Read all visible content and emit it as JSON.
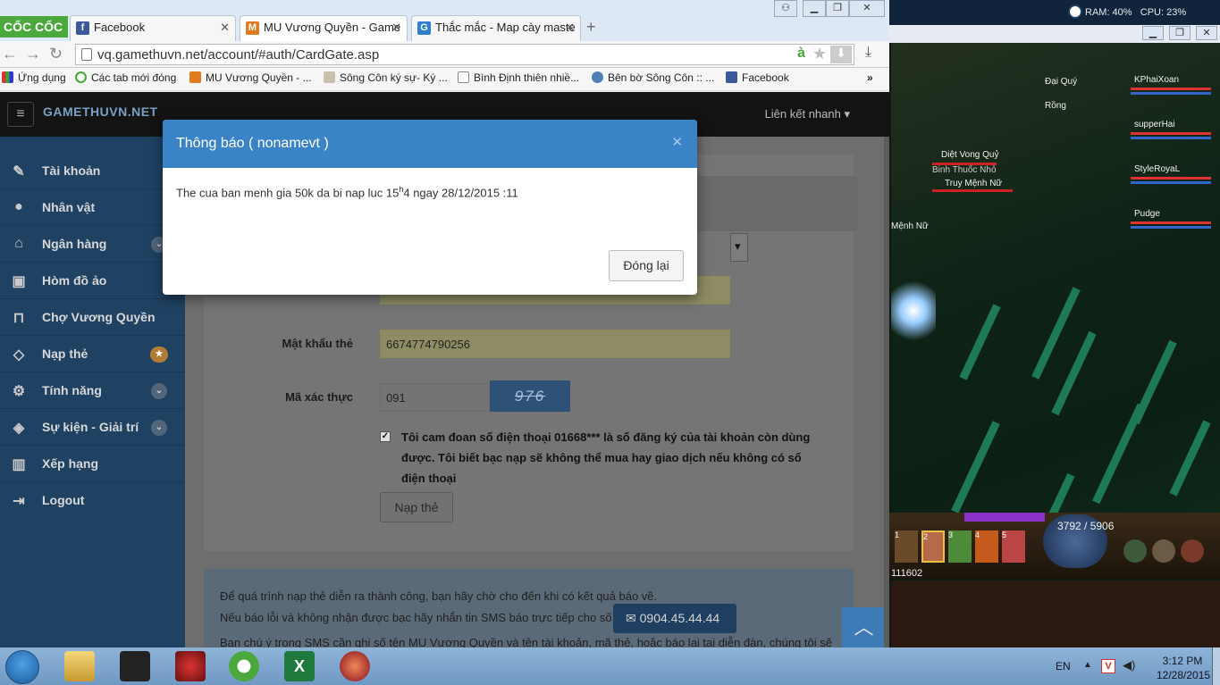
{
  "browser": {
    "brand": "CỐC CỐC",
    "tabs": [
      {
        "label": "Facebook",
        "icon": "facebook-icon"
      },
      {
        "label": "MU Vương Quyền - Game",
        "icon": "mu-icon"
      },
      {
        "label": "Thắc mắc - Map cày maste",
        "icon": "g-icon"
      }
    ],
    "url": "vq.gamethuvn.net/account/#auth/CardGate.asp",
    "bookmarks": [
      "Ứng dụng",
      "Các tab mới đóng",
      "MU Vương Quyền - ...",
      "Sông Côn ký sự- Ký ...",
      "Bình Định thiên nhiề...",
      "Bên bờ Sông Côn :: ...",
      "Facebook"
    ],
    "bookmarks_more": "»"
  },
  "site": {
    "logo": "GAMETHUVN.NET",
    "quick_link": "Liên kết nhanh ▾",
    "menu": [
      {
        "label": "Tài khoản",
        "icon": "edit-icon"
      },
      {
        "label": "Nhân vật",
        "icon": "user-icon"
      },
      {
        "label": "Ngân hàng",
        "icon": "bank-icon"
      },
      {
        "label": "Hòm đồ ảo",
        "icon": "briefcase-icon"
      },
      {
        "label": "Chợ Vương Quyền",
        "icon": "cart-icon"
      },
      {
        "label": "Nạp thẻ",
        "icon": "diamond-icon"
      },
      {
        "label": "Tính năng",
        "icon": "gears-icon"
      },
      {
        "label": "Sự kiện - Giải trí",
        "icon": "handshake-icon"
      },
      {
        "label": "Xếp hạng",
        "icon": "bar-chart-icon"
      },
      {
        "label": "Logout",
        "icon": "sign-out-icon"
      }
    ],
    "form": {
      "password_label": "Mật khẩu thẻ",
      "password_value": "6674774790256",
      "captcha_label": "Mã xác thực",
      "captcha_value": "091",
      "captcha_image_text": "976",
      "agree_text": "Tôi cam đoan số điện thoại 01668*** là số đăng ký của tài khoản còn dùng được. Tôi biết bạc nạp sẽ không thể mua hay giao dịch nếu không có số điện thoại",
      "submit": "Nạp thẻ"
    },
    "info": {
      "line1": "Để quá trình nạp thẻ diễn ra thành công, bạn hãy chờ cho đến khi có kết quả báo về.",
      "line2": "Nếu báo lỗi và không nhận được bạc hãy nhắn tin SMS báo trực tiếp cho số:",
      "phone": "0904.45.44.44",
      "line3": "Bạn chú ý trong SMS cần ghi số tên MU Vương Quyền và tên tài khoản, mã thẻ, hoặc báo lại tại diễn đàn, chúng tôi sẽ"
    }
  },
  "modal": {
    "title": "Thông báo ( nonamevt )",
    "body_pre": "The cua ban menh gia 50k da bi nap luc 15",
    "body_sup": "h",
    "body_post": "4 ngay 28/12/2015 :11",
    "close_button": "Đóng lại"
  },
  "game": {
    "ram": "RAM: 40%",
    "cpu": "CPU: 23%",
    "party": [
      "KPhaiXoan",
      "supperHai",
      "StyleRoyaL",
      "Pudge"
    ],
    "labels": [
      "Đại Quý",
      "Rồng",
      "Diệt Vong Quỷ",
      "Binh Thuốc Nhỏ",
      "Truy Mệnh Nữ",
      "Mệnh Nữ"
    ],
    "hp": "3792 / 5906",
    "coords": "111602",
    "skill_slots": [
      "1",
      "2",
      "3",
      "4",
      "5"
    ]
  },
  "taskbar": {
    "lang": "EN",
    "time": "3:12 PM",
    "date": "12/28/2015"
  }
}
